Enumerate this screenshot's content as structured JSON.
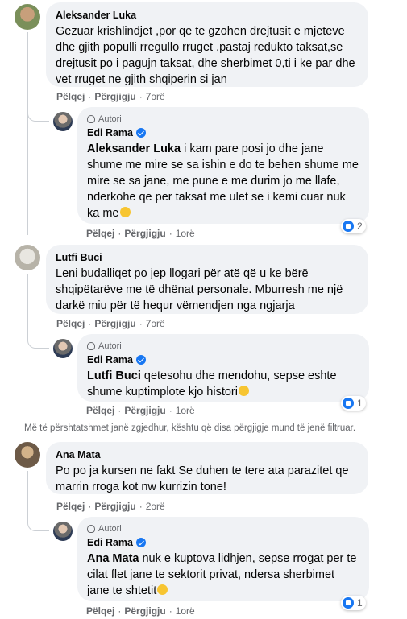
{
  "colors": {
    "bubble": "#f0f2f5",
    "link": "#65676b",
    "verified": "#1877f2"
  },
  "actions": {
    "like": "Pëlqej",
    "reply": "Përgjigju"
  },
  "author_badge": "Autori",
  "comments": [
    {
      "author": "Aleksander Luka",
      "text": "Gezuar krishlindjet ,por qe te gzohen drejtusit e mjeteve dhe gjith populli rregullo rruget ,pastaj redukto taksat,se drejtusit po i pagujn taksat, dhe sherbimet 0,ti i ke par dhe vet rruget ne gjith shqiperin si jan",
      "time": "7orë",
      "reply": {
        "author": "Edi Rama",
        "mention": "Aleksander Luka",
        "text": " i kam pare posi jo dhe jane shume me mire se sa ishin e do te behen shume me mire se sa jane, me pune e me durim jo me llafe, nderkohe qe per taksat me ulet se i kemi cuar nuk ka me",
        "time": "1orë",
        "reactions": "2"
      }
    },
    {
      "author": "Lutfi Buci",
      "text": "Leni budalliqet po jep llogari për atë që u ke bërë shqipëtarëve me të dhënat personale. Mburresh me një darkë miu për të hequr vëmendjen nga ngjarja",
      "time": "7orë",
      "reply": {
        "author": "Edi Rama",
        "mention": "Lutfi Buci",
        "text": " qetesohu dhe mendohu, sepse eshte shume kuptimplote kjo histori",
        "time": "1orë",
        "reactions": "1"
      }
    },
    {
      "author": "Ana Mata",
      "text": "Po po ja kursen ne fakt Se duhen te tere ata parazitet qe marrin rroga kot nw kurrizin tone!",
      "time": "2orë",
      "reply": {
        "author": "Edi Rama",
        "mention": "Ana Mata",
        "text": " nuk e kuptova lidhjen, sepse rrogat per te cilat flet jane te sektorit privat, ndersa sherbimet jane te shtetit",
        "time": "1orë",
        "reactions": "1"
      }
    }
  ],
  "filter_notice": "Më të përshtatshmet janë zgjedhur, kështu që disa përgjigje mund të jenë filtruar."
}
